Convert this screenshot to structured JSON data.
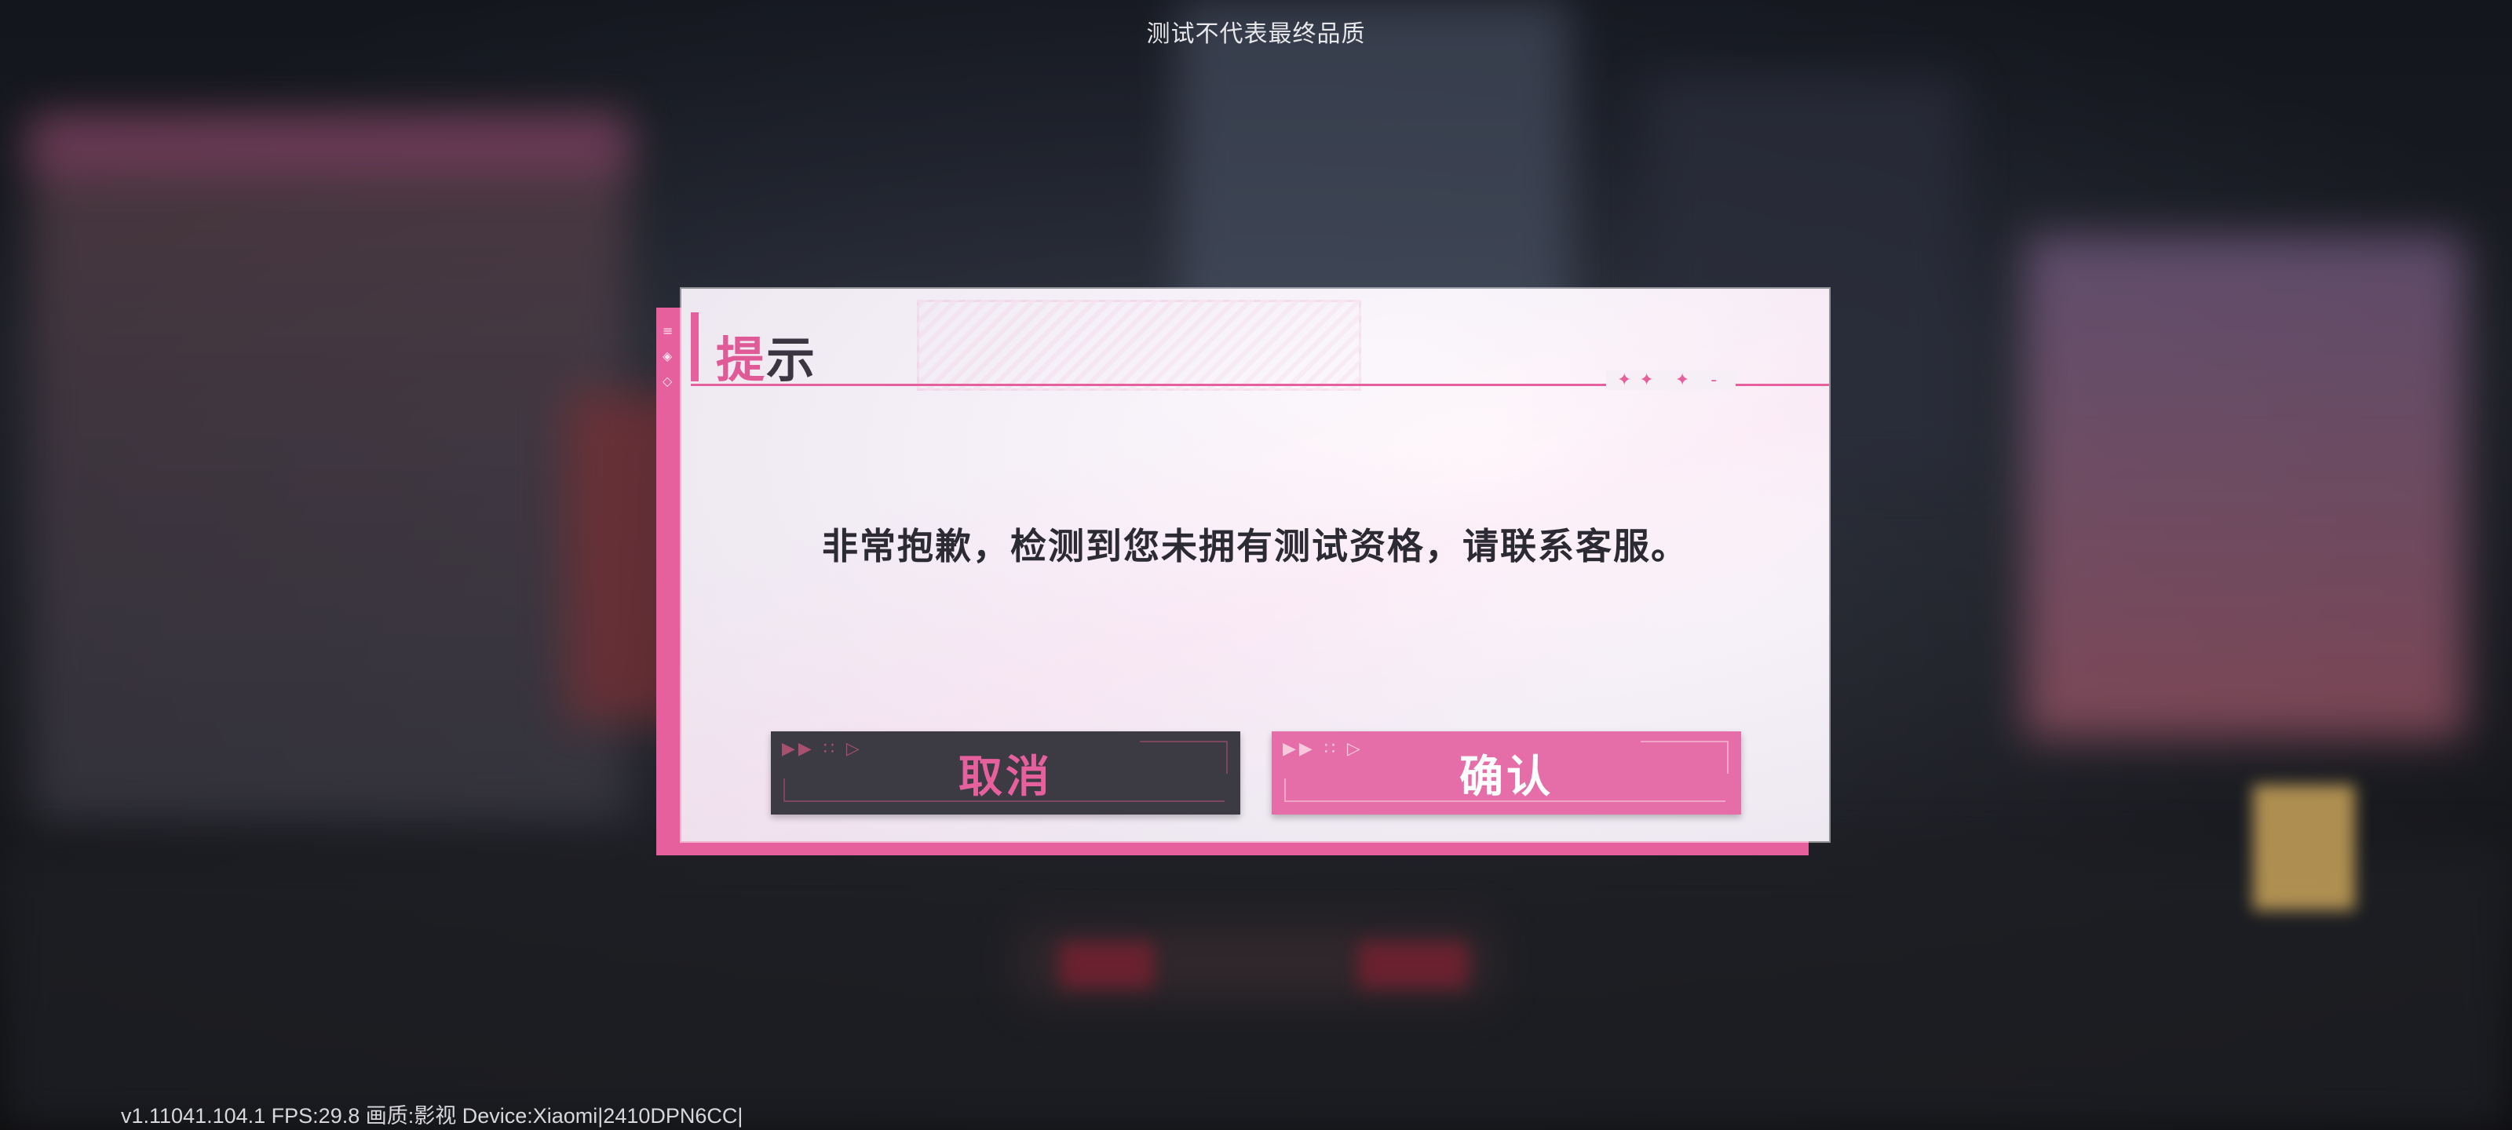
{
  "header": {
    "notice": "测试不代表最终品质"
  },
  "dialog": {
    "title_first_char": "提",
    "title_rest": "示",
    "title_rule_stars": "✦✦ ✦ -",
    "message": "非常抱歉，检测到您未拥有测试资格，请联系客服。",
    "cancel_label": "取消",
    "confirm_label": "确认",
    "button_deco": "▶▶ ∷ ▷"
  },
  "footer": {
    "version_info": "v1.11041.104.1 FPS:29.8 画质:影视 Device:Xiaomi|2410DPN6CC|"
  },
  "colors": {
    "accent_pink": "#e6609e",
    "cancel_bg": "#3c3a42",
    "confirm_bg": "#e56ea9",
    "panel_bg": "#f3eef5"
  }
}
